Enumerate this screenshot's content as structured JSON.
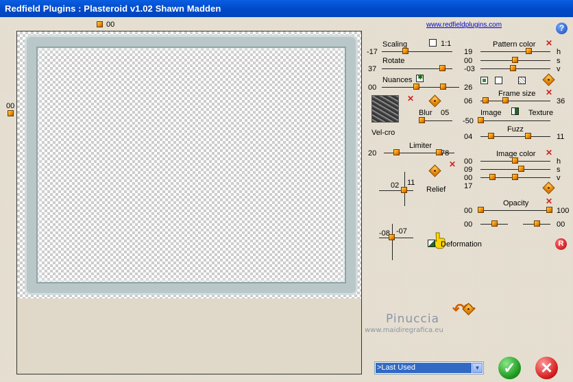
{
  "window": {
    "title": "Redfield Plugins : Plasteroid v1.02   Shawn Madden"
  },
  "link": "www.redfieldplugins.com",
  "preview": {
    "top_value": "00",
    "left_value": "00"
  },
  "scaling": {
    "label": "Scaling",
    "value": "-17",
    "ratio_label": "1:1"
  },
  "rotate": {
    "label": "Rotate",
    "value": "37"
  },
  "nuances": {
    "label": "Nuances",
    "min": "00",
    "max": "26"
  },
  "velcro": {
    "label": "Vel-cro"
  },
  "blur": {
    "label": "Blur",
    "value": "05"
  },
  "limiter": {
    "label": "Limiter",
    "min": "20",
    "max": "78"
  },
  "relief": {
    "label": "Relief",
    "x": "02",
    "y": "11"
  },
  "deformation": {
    "label": "Deformation",
    "x": "-08",
    "y": "-07"
  },
  "pattern_color": {
    "label": "Pattern color",
    "h": "19",
    "s": "00",
    "v": "-03",
    "h_label": "h",
    "s_label": "s",
    "v_label": "v"
  },
  "frame_size": {
    "label": "Frame size",
    "min": "06",
    "max": "36"
  },
  "image_texture": {
    "left_label": "Image",
    "right_label": "Texture",
    "value": "-50"
  },
  "fuzz": {
    "label": "Fuzz",
    "min": "04",
    "max": "11"
  },
  "image_color": {
    "label": "Image color",
    "h": "00",
    "s": "09",
    "v": "00",
    "extra": "17",
    "h_label": "h",
    "s_label": "s",
    "v_label": "v"
  },
  "opacity": {
    "label": "Opacity",
    "min": "00",
    "max": "100",
    "row2_left": "00",
    "row2_right": "00"
  },
  "watermark": {
    "line1": "Pinuccia",
    "line2": "www.maidiregrafica.eu"
  },
  "preset": {
    "selected": ">Last Used"
  },
  "icons": {
    "help": "help-icon",
    "ok": "check-icon",
    "cancel": "cancel-x-icon",
    "reset": "reset-r-icon"
  }
}
